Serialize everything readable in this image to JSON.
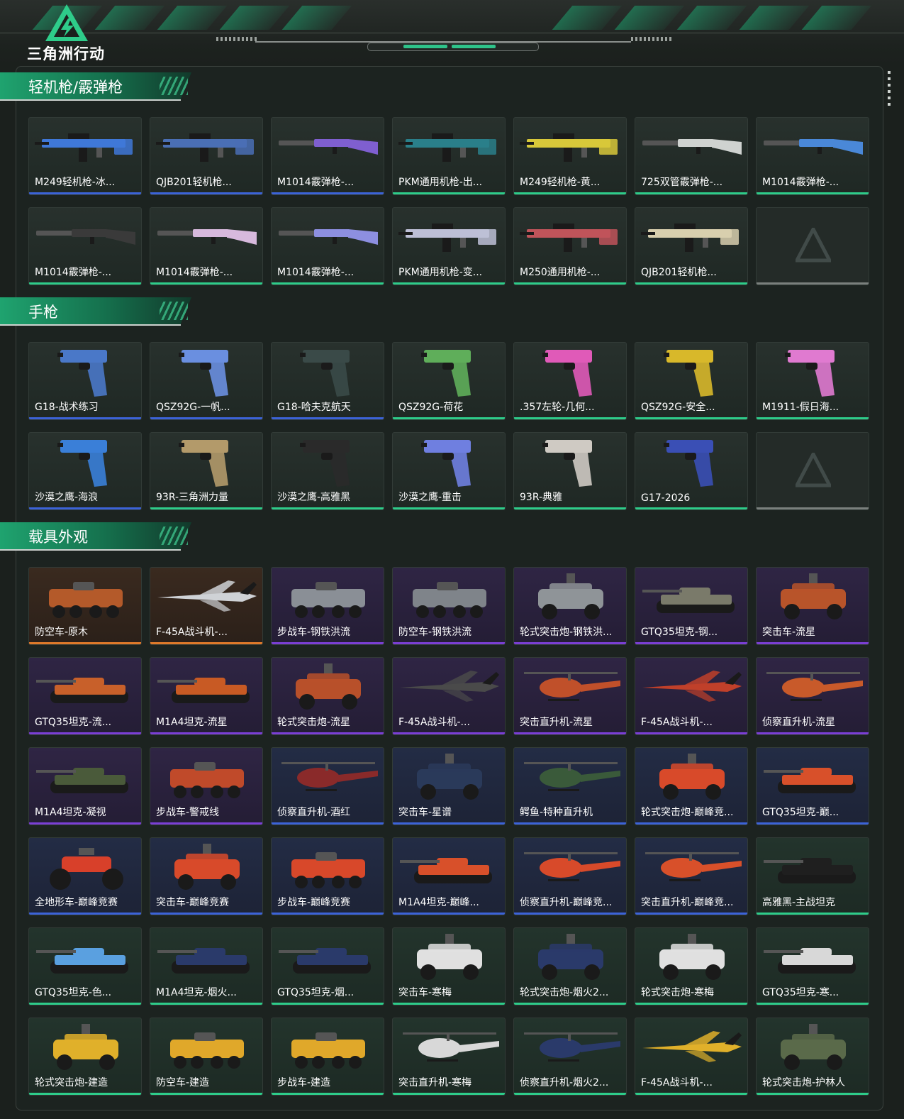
{
  "header": {
    "logo_text": "三角洲行动"
  },
  "colors": {
    "accent": "#2ecc8a",
    "blue_rarity": "#3c63d8",
    "purple_rarity": "#7b3fd6",
    "orange_rarity": "#e07a2a"
  },
  "sections": [
    {
      "title": "轻机枪/霰弹枪",
      "items": [
        {
          "label": "M249轻机枪-冰...",
          "rarity": "blue",
          "kind": "rifle",
          "tint": "#3f78d8"
        },
        {
          "label": "QJB201轻机枪...",
          "rarity": "blue",
          "kind": "rifle",
          "tint": "#4a6fb5"
        },
        {
          "label": "M1014霰弹枪-...",
          "rarity": "blue",
          "kind": "shotgun",
          "tint": "#7f5fd0"
        },
        {
          "label": "PKM通用机枪-出...",
          "rarity": "green",
          "kind": "rifle",
          "tint": "#2a7f8a"
        },
        {
          "label": "M249轻机枪-黄...",
          "rarity": "green",
          "kind": "rifle",
          "tint": "#d8c83a"
        },
        {
          "label": "725双管霰弹枪-...",
          "rarity": "green",
          "kind": "shotgun",
          "tint": "#cfd2d0"
        },
        {
          "label": "M1014霰弹枪-...",
          "rarity": "green",
          "kind": "shotgun",
          "tint": "#4a88d8"
        },
        {
          "label": "M1014霰弹枪-...",
          "rarity": "green",
          "kind": "shotgun",
          "tint": "#3a3a3a"
        },
        {
          "label": "M1014霰弹枪-...",
          "rarity": "green",
          "kind": "shotgun",
          "tint": "#d7b9dd"
        },
        {
          "label": "M1014霰弹枪-...",
          "rarity": "green",
          "kind": "shotgun",
          "tint": "#8d8fe0"
        },
        {
          "label": "PKM通用机枪-变...",
          "rarity": "green",
          "kind": "rifle",
          "tint": "#bdbfd6"
        },
        {
          "label": "M250通用机枪-...",
          "rarity": "green",
          "kind": "rifle",
          "tint": "#c0545a"
        },
        {
          "label": "QJB201轻机枪...",
          "rarity": "green",
          "kind": "rifle",
          "tint": "#d8cfae"
        },
        {
          "label": "",
          "rarity": "gray",
          "kind": "placeholder",
          "tint": "#3a423e"
        }
      ]
    },
    {
      "title": "手枪",
      "items": [
        {
          "label": "G18-战术练习",
          "rarity": "blue",
          "kind": "pistol",
          "tint": "#4a78c8"
        },
        {
          "label": "QSZ92G-一帆...",
          "rarity": "blue",
          "kind": "pistol",
          "tint": "#6a8fe0"
        },
        {
          "label": "G18-哈夫克航天",
          "rarity": "blue",
          "kind": "pistol",
          "tint": "#3a4a48"
        },
        {
          "label": "QSZ92G-荷花",
          "rarity": "green",
          "kind": "pistol",
          "tint": "#5fae5a"
        },
        {
          "label": ".357左轮-几何...",
          "rarity": "green",
          "kind": "pistol",
          "tint": "#e05ab8"
        },
        {
          "label": "QSZ92G-安全...",
          "rarity": "green",
          "kind": "pistol",
          "tint": "#d8b82a"
        },
        {
          "label": "M1911-假日海...",
          "rarity": "green",
          "kind": "pistol",
          "tint": "#e07ad0"
        },
        {
          "label": "沙漠之鹰-海浪",
          "rarity": "blue",
          "kind": "pistol",
          "tint": "#3a7fd8"
        },
        {
          "label": "93R-三角洲力量",
          "rarity": "green",
          "kind": "pistol",
          "tint": "#b39a6a"
        },
        {
          "label": "沙漠之鹰-高雅黑",
          "rarity": "green",
          "kind": "pistol",
          "tint": "#2a2a2a"
        },
        {
          "label": "沙漠之鹰-重击",
          "rarity": "green",
          "kind": "pistol",
          "tint": "#6f7fe0"
        },
        {
          "label": "93R-典雅",
          "rarity": "green",
          "kind": "pistol",
          "tint": "#cfcac3"
        },
        {
          "label": "G17-2026",
          "rarity": "green",
          "kind": "pistol",
          "tint": "#3a4fb5"
        },
        {
          "label": "",
          "rarity": "gray",
          "kind": "placeholder",
          "tint": "#3a423e"
        }
      ]
    },
    {
      "title": "载具外观",
      "items": [
        {
          "label": "防空车-原木",
          "rarity": "orange",
          "bg": "orange",
          "kind": "apc",
          "tint": "#b45a2a"
        },
        {
          "label": "F-45A战斗机-...",
          "rarity": "orange",
          "bg": "orange",
          "kind": "jet",
          "tint": "#cfd2d6"
        },
        {
          "label": "步战车-钢铁洪流",
          "rarity": "purple",
          "bg": "purple",
          "kind": "apc",
          "tint": "#8a8f96"
        },
        {
          "label": "防空车-钢铁洪流",
          "rarity": "purple",
          "bg": "purple",
          "kind": "apc",
          "tint": "#7f848a"
        },
        {
          "label": "轮式突击炮-钢铁洪...",
          "rarity": "purple",
          "bg": "purple",
          "kind": "truck",
          "tint": "#8f9498"
        },
        {
          "label": "GTQ35坦克-钢...",
          "rarity": "purple",
          "bg": "purple",
          "kind": "tank",
          "tint": "#7a7a6a"
        },
        {
          "label": "突击车-流星",
          "rarity": "purple",
          "bg": "purple",
          "kind": "truck",
          "tint": "#b8542a"
        },
        {
          "label": "GTQ35坦克-流...",
          "rarity": "purple",
          "bg": "purple",
          "kind": "tank",
          "tint": "#c8602a"
        },
        {
          "label": "M1A4坦克-流星",
          "rarity": "purple",
          "bg": "purple",
          "kind": "tank",
          "tint": "#c85a24"
        },
        {
          "label": "轮式突击炮-流星",
          "rarity": "purple",
          "bg": "purple",
          "kind": "truck",
          "tint": "#b8502a"
        },
        {
          "label": "F-45A战斗机-...",
          "rarity": "purple",
          "bg": "purple",
          "kind": "jet",
          "tint": "#4a4a4a"
        },
        {
          "label": "突击直升机-流星",
          "rarity": "purple",
          "bg": "purple",
          "kind": "heli",
          "tint": "#c0502a"
        },
        {
          "label": "F-45A战斗机-...",
          "rarity": "purple",
          "bg": "purple",
          "kind": "jet",
          "tint": "#c0402a"
        },
        {
          "label": "侦察直升机-流星",
          "rarity": "purple",
          "bg": "purple",
          "kind": "heli",
          "tint": "#c85a2a"
        },
        {
          "label": "M1A4坦克-凝视",
          "rarity": "purple",
          "bg": "purple",
          "kind": "tank",
          "tint": "#4a5a3a"
        },
        {
          "label": "步战车-警戒线",
          "rarity": "purple",
          "bg": "purple",
          "kind": "apc",
          "tint": "#c04a2a"
        },
        {
          "label": "侦察直升机-酒红",
          "rarity": "blue",
          "bg": "blue",
          "kind": "heli",
          "tint": "#8a2a2a"
        },
        {
          "label": "突击车-星谱",
          "rarity": "blue",
          "bg": "blue",
          "kind": "truck",
          "tint": "#2a3a5a"
        },
        {
          "label": "鳄鱼-特种直升机",
          "rarity": "blue",
          "bg": "blue",
          "kind": "heli",
          "tint": "#3a5a3a"
        },
        {
          "label": "轮式突击炮-巅峰竞...",
          "rarity": "blue",
          "bg": "blue",
          "kind": "truck",
          "tint": "#d84a2a"
        },
        {
          "label": "GTQ35坦克-巅...",
          "rarity": "blue",
          "bg": "blue",
          "kind": "tank",
          "tint": "#d8502a"
        },
        {
          "label": "全地形车-巅峰竞赛",
          "rarity": "blue",
          "bg": "blue",
          "kind": "atv",
          "tint": "#d8402a"
        },
        {
          "label": "突击车-巅峰竞赛",
          "rarity": "blue",
          "bg": "blue",
          "kind": "truck",
          "tint": "#d84a2a"
        },
        {
          "label": "步战车-巅峰竞赛",
          "rarity": "blue",
          "bg": "blue",
          "kind": "apc",
          "tint": "#d8482a"
        },
        {
          "label": "M1A4坦克-巅峰...",
          "rarity": "blue",
          "bg": "blue",
          "kind": "tank",
          "tint": "#d8502a"
        },
        {
          "label": "侦察直升机-巅峰竞...",
          "rarity": "blue",
          "bg": "blue",
          "kind": "heli",
          "tint": "#d84a2a"
        },
        {
          "label": "突击直升机-巅峰竞...",
          "rarity": "blue",
          "bg": "blue",
          "kind": "heli",
          "tint": "#d8502a"
        },
        {
          "label": "高雅黑-主战坦克",
          "rarity": "green",
          "bg": "green",
          "kind": "tank",
          "tint": "#1f1f1f"
        },
        {
          "label": "GTQ35坦克-色...",
          "rarity": "green",
          "bg": "green",
          "kind": "tank",
          "tint": "#5aa0e0"
        },
        {
          "label": "M1A4坦克-烟火...",
          "rarity": "green",
          "bg": "green",
          "kind": "tank",
          "tint": "#2a3a6a"
        },
        {
          "label": "GTQ35坦克-烟...",
          "rarity": "green",
          "bg": "green",
          "kind": "tank",
          "tint": "#2a3a6a"
        },
        {
          "label": "突击车-寒梅",
          "rarity": "green",
          "bg": "green",
          "kind": "truck",
          "tint": "#e0e0e0"
        },
        {
          "label": "轮式突击炮-烟火2...",
          "rarity": "green",
          "bg": "green",
          "kind": "truck",
          "tint": "#2a3a6a"
        },
        {
          "label": "轮式突击炮-寒梅",
          "rarity": "green",
          "bg": "green",
          "kind": "truck",
          "tint": "#e0e0e0"
        },
        {
          "label": "GTQ35坦克-寒...",
          "rarity": "green",
          "bg": "green",
          "kind": "tank",
          "tint": "#d8d8d8"
        },
        {
          "label": "轮式突击炮-建造",
          "rarity": "green",
          "bg": "green",
          "kind": "truck",
          "tint": "#e0b02a"
        },
        {
          "label": "防空车-建造",
          "rarity": "green",
          "bg": "green",
          "kind": "apc",
          "tint": "#e0a82a"
        },
        {
          "label": "步战车-建造",
          "rarity": "green",
          "bg": "green",
          "kind": "apc",
          "tint": "#e0a82a"
        },
        {
          "label": "突击直升机-寒梅",
          "rarity": "green",
          "bg": "green",
          "kind": "heli",
          "tint": "#d8d8d8"
        },
        {
          "label": "侦察直升机-烟火2...",
          "rarity": "green",
          "bg": "green",
          "kind": "heli",
          "tint": "#2a3a6a"
        },
        {
          "label": "F-45A战斗机-...",
          "rarity": "green",
          "bg": "green",
          "kind": "jet",
          "tint": "#e0b02a"
        },
        {
          "label": "轮式突击炮-护林人",
          "rarity": "green",
          "bg": "green",
          "kind": "truck",
          "tint": "#5a6a4a"
        }
      ]
    }
  ]
}
